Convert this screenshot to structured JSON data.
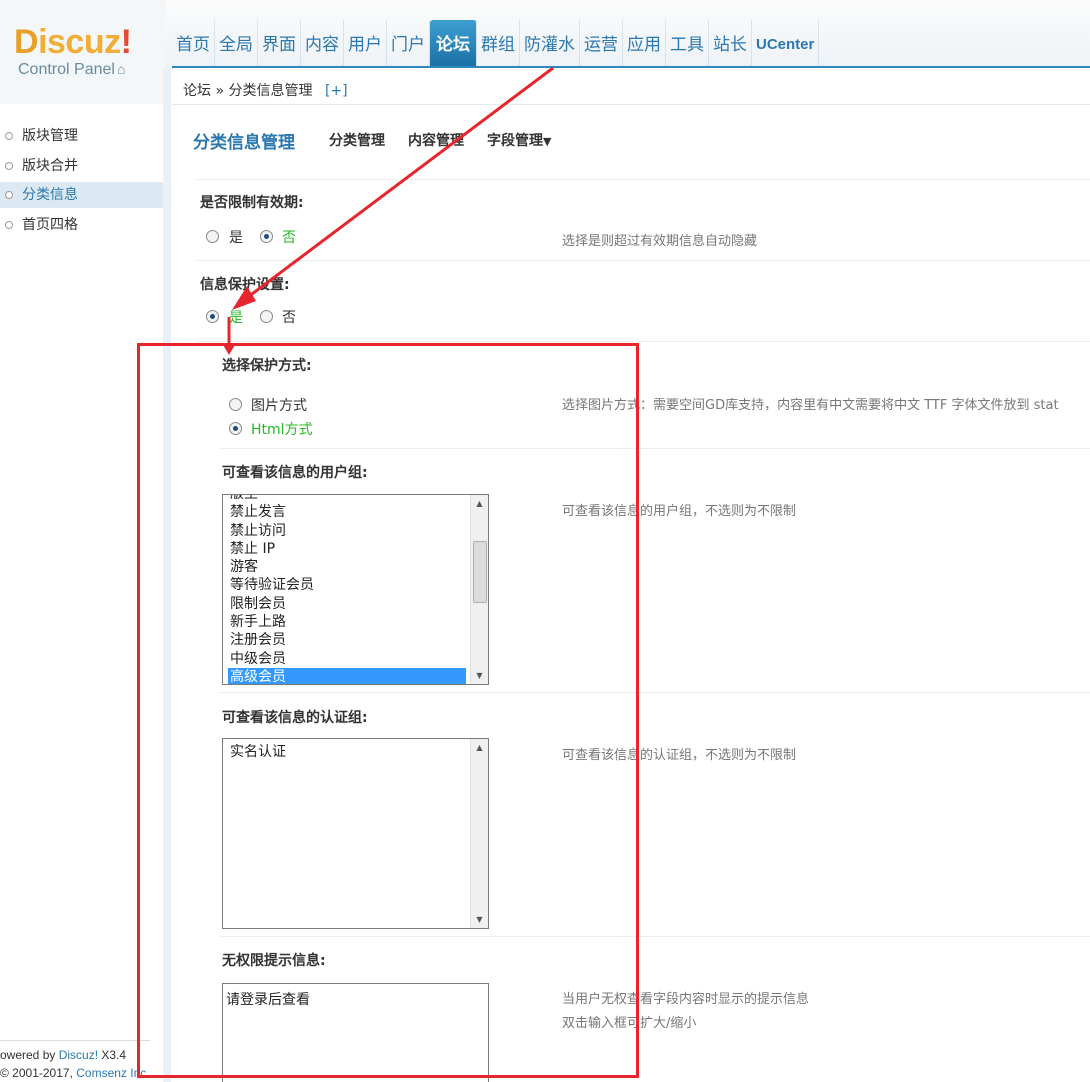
{
  "logo": {
    "word_d": "D",
    "word_rest": "iscuz",
    "word_bang": "!",
    "sub": "Control Panel"
  },
  "topnav": [
    "首页",
    "全局",
    "界面",
    "内容",
    "用户",
    "门户",
    "论坛",
    "群组",
    "防灌水",
    "运营",
    "应用",
    "工具",
    "站长",
    "UCenter"
  ],
  "topnav_active": "论坛",
  "breadcrumb": {
    "parent": "论坛",
    "sep": "»",
    "current": "分类信息管理",
    "add": "[+]"
  },
  "sidebar": {
    "items": [
      "版块管理",
      "版块合并",
      "分类信息",
      "首页四格"
    ],
    "active": "分类信息"
  },
  "footer": {
    "line1_prefix": "owered by ",
    "line1_brand": "Discuz!",
    "line1_ver": " X3.4",
    "line2_prefix": "© 2001-2017, ",
    "line2_brand": "Comsenz Inc."
  },
  "main": {
    "title": "分类信息管理",
    "tabs": [
      "分类管理",
      "内容管理",
      "字段管理"
    ],
    "tab_dropdown": "▼",
    "expiry": {
      "label": "是否限制有效期:",
      "yes": "是",
      "no": "否",
      "selected": "否",
      "hint": "选择是则超过有效期信息自动隐藏"
    },
    "protect": {
      "label": "信息保护设置:",
      "yes": "是",
      "no": "否",
      "selected": "是"
    },
    "protect_mode": {
      "label": "选择保护方式:",
      "options": [
        "图片方式",
        "Html方式"
      ],
      "selected": "Html方式",
      "hint": "选择图片方式：需要空间GD库支持，内容里有中文需要将中文 TTF 字体文件放到 stat"
    },
    "user_groups": {
      "label": "可查看该信息的用户组:",
      "partial_top": "版主",
      "items": [
        "禁止发言",
        "禁止访问",
        "禁止 IP",
        "游客",
        "等待验证会员",
        "限制会员",
        "新手上路",
        "注册会员",
        "中级会员",
        "高级会员"
      ],
      "selected": "高级会员",
      "hint": "可查看该信息的用户组，不选则为不限制"
    },
    "verify_groups": {
      "label": "可查看该信息的认证组:",
      "items": [
        "实名认证"
      ],
      "hint": "可查看该信息的认证组，不选则为不限制"
    },
    "no_perm": {
      "label": "无权限提示信息:",
      "value": "请登录后查看",
      "hint1": "当用户无权查看字段内容时显示的提示信息",
      "hint2": "双击输入框可扩大/缩小"
    }
  },
  "colors": {
    "accent": "#2b78b0",
    "nav_active": "#1c71a7",
    "logo_orange": "#f0a830",
    "selected_option": "#22bb22",
    "annotation_red": "#e8242c",
    "list_selection": "#3399ff"
  }
}
